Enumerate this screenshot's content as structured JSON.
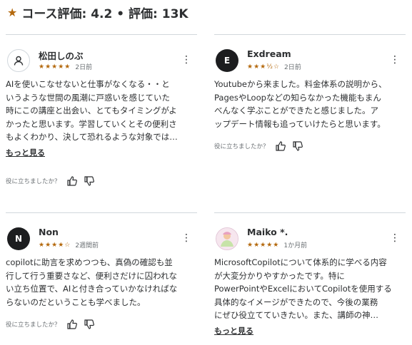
{
  "header": {
    "star_icon": "star-icon",
    "title": "コース評価: 4.2 • 評価: 13K"
  },
  "colors": {
    "star": "#b4690e",
    "text": "#2d2f31",
    "muted": "#6a6f73",
    "divider": "#d1d7dc"
  },
  "reviews": [
    {
      "name": "松田しのぶ",
      "avatar": "user-icon",
      "stars": "★★★★★",
      "rating": 5,
      "date": "2日前",
      "lines": [
        "AIを使いこなせないと仕事がなくなる・・と",
        "いうような世間の風潮に戸惑いを感じていた",
        "時にこの講座と出会い、とてもタイミングがよ",
        "かったと思います。学習していくとその便利さ",
        "もよくわかり、決して恐れるような対象では…"
      ],
      "more": "もっと見る",
      "helpful": "役に立ちましたか？"
    },
    {
      "name": "Exdream",
      "avatar_initial": "E",
      "stars": "★★★½☆",
      "rating": 3.5,
      "date": "2日前",
      "lines": [
        "Youtubeから来ました。料金体系の説明から、",
        "PagesやLoopなどの知らなかった機能もまん",
        "べんなく学ぶことができたと感じました。ア",
        "ップデート情報も追っていけたらと思います。"
      ],
      "helpful": "役に立ちましたか？"
    },
    {
      "name": "Non",
      "avatar_initial": "N",
      "stars": "★★★★☆",
      "rating": 4,
      "date": "2週間前",
      "lines": [
        "copilotに助言を求めつつも、真偽の確認も並",
        "行して行う重要さなど、便利さだけに囚われな",
        "い立ち位置で、AIと付き合っていかなければな",
        "らないのだということも学べました。"
      ],
      "helpful": "役に立ちましたか？"
    },
    {
      "name": "Maiko *.",
      "avatar": "profile-photo",
      "stars": "★★★★★",
      "rating": 5,
      "date": "1か月前",
      "lines": [
        "MicrosoftCopilotについて体系的に学べる内容",
        "が大変分かりやすかったです。特に",
        "PowerPointやExcelにおいてCopilotを使用する",
        "具体的なイメージができたので、今後の業務",
        "にぜひ役立てていきたい。また、講師の神…"
      ],
      "more": "もっと見る"
    }
  ]
}
